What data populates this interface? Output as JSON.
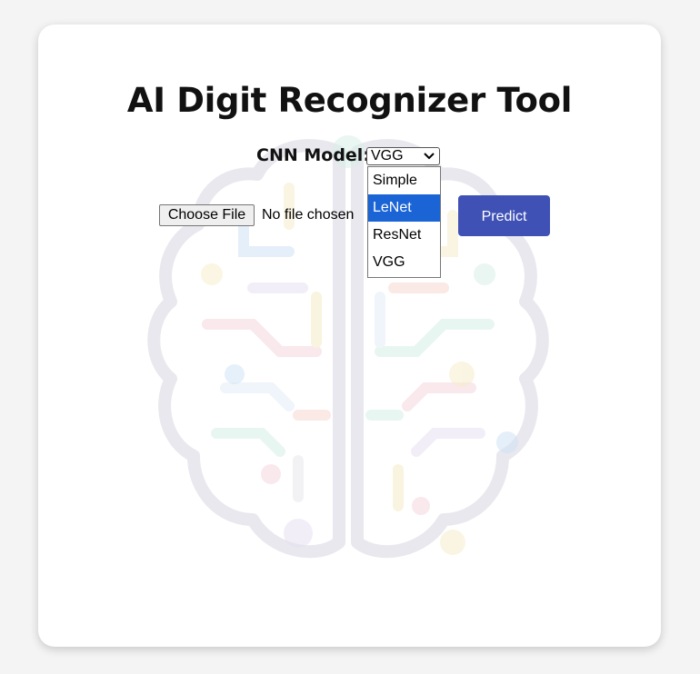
{
  "page": {
    "title": "AI Digit Recognizer Tool"
  },
  "model_selector": {
    "label": "CNN Model:",
    "selected": "VGG",
    "options": [
      "Simple",
      "LeNet",
      "ResNet",
      "VGG"
    ],
    "highlighted": "LeNet"
  },
  "file_input": {
    "button_label": "Choose File",
    "status": "No file chosen"
  },
  "predict": {
    "label": "Predict"
  },
  "colors": {
    "primary": "#3f51b5",
    "highlight": "#1a64d6",
    "background": "#f4f4f4",
    "card": "#ffffff"
  },
  "icons": {
    "background": "brain-circuit-icon",
    "select_arrow": "chevron-down-icon"
  }
}
